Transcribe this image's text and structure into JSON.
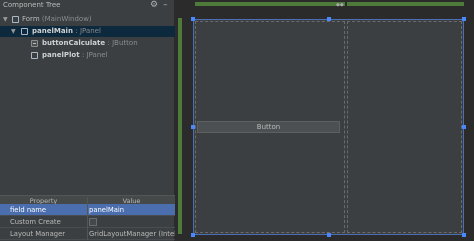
{
  "component_tree": {
    "title": "Component Tree",
    "nodes": [
      {
        "name": "Form",
        "type": "(MainWindow)"
      },
      {
        "name": "panelMain",
        "type": ": JPanel"
      },
      {
        "name": "buttonCalculate",
        "type": ": JButton"
      },
      {
        "name": "panelPlot",
        "type": ": JPanel"
      }
    ]
  },
  "properties": {
    "header": {
      "property": "Property",
      "value": "Value"
    },
    "rows": [
      {
        "name": "field name",
        "value": "panelMain"
      },
      {
        "name": "Custom Create",
        "value": ""
      },
      {
        "name": "Layout Manager",
        "value": "GridLayoutManager (IntelliJ)"
      }
    ]
  },
  "designer": {
    "button_label": "Button"
  },
  "colors": {
    "accent": "#4a88ff",
    "selection": "#4b6eaf",
    "grid_strip": "#4e7a3a"
  }
}
